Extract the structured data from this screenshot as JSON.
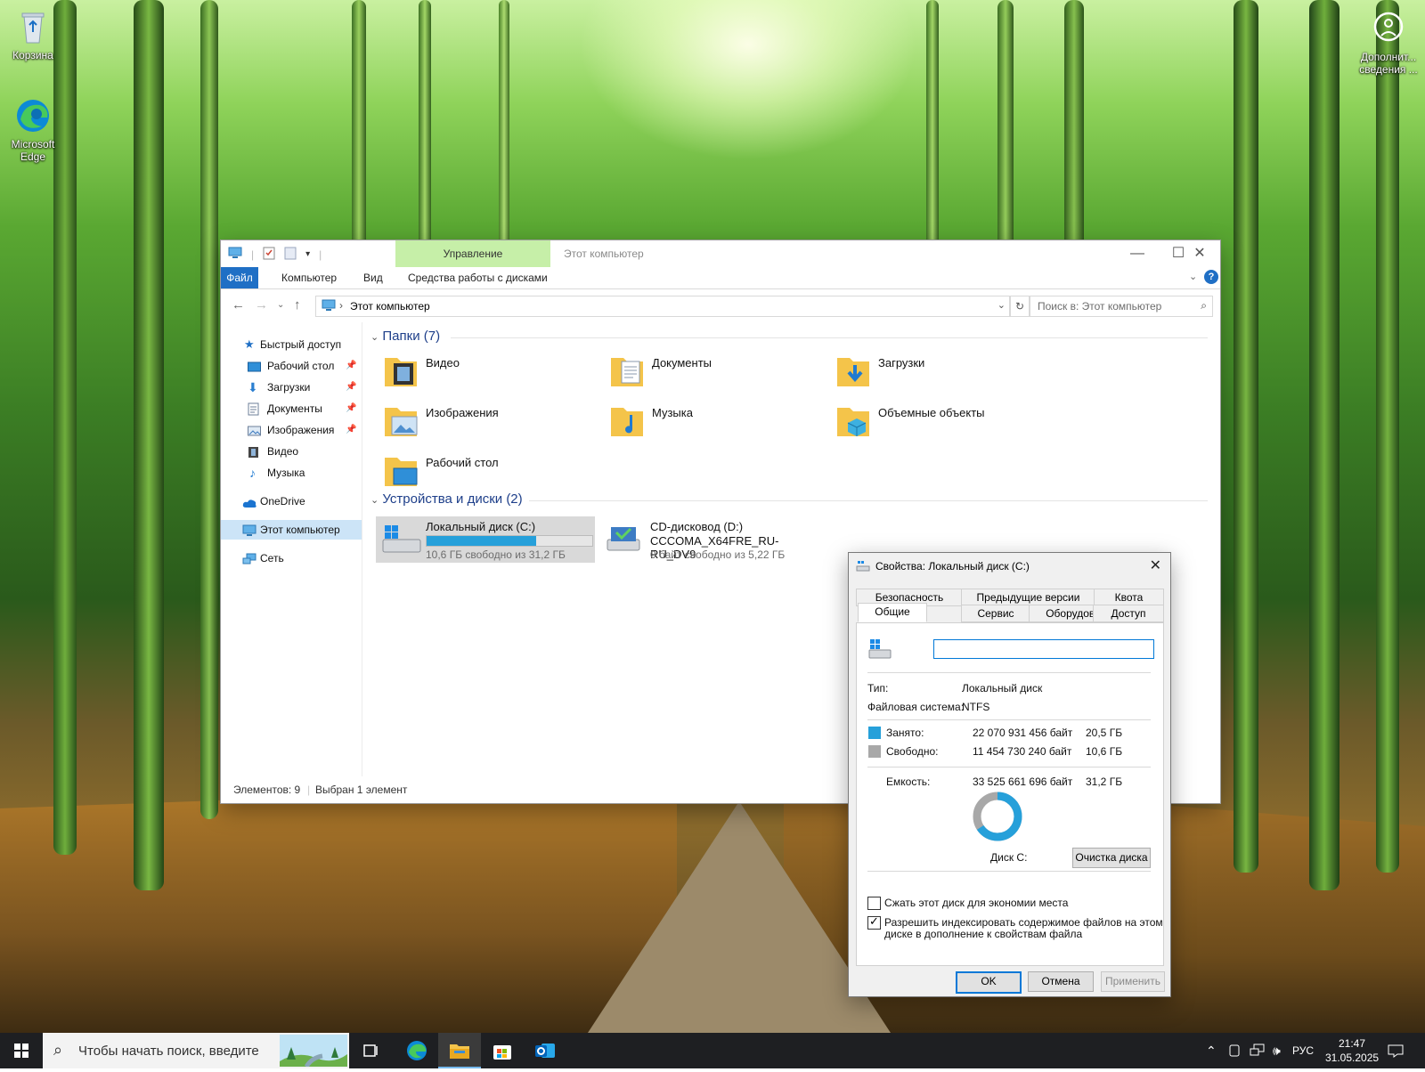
{
  "desktop": {
    "icons": [
      {
        "label": "Корзина",
        "icon": "recycle-bin-icon"
      },
      {
        "label": "Microsoft Edge",
        "icon": "edge-icon"
      }
    ],
    "widget": {
      "label": "Дополнит... сведения ...",
      "icon": "help-circle-icon"
    }
  },
  "explorer": {
    "context_tab": "Управление",
    "title": "Этот компьютер",
    "ribbon_tabs": [
      "Файл",
      "Компьютер",
      "Вид",
      "Средства работы с дисками"
    ],
    "address": "Этот компьютер",
    "search_placeholder": "Поиск в: Этот компьютер",
    "nav": {
      "quick_access": "Быстрый доступ",
      "items": [
        "Рабочий стол",
        "Загрузки",
        "Документы",
        "Изображения",
        "Видео",
        "Музыка"
      ],
      "onedrive": "OneDrive",
      "this_pc": "Этот компьютер",
      "network": "Сеть"
    },
    "folders_header": "Папки (7)",
    "folders": [
      "Видео",
      "Документы",
      "Загрузки",
      "Изображения",
      "Музыка",
      "Объемные объекты",
      "Рабочий стол"
    ],
    "drives_header": "Устройства и диски (2)",
    "drives": [
      {
        "name": "Локальный диск (C:)",
        "free_text": "10,6 ГБ свободно из 31,2 ГБ",
        "used_fraction": 0.66
      },
      {
        "name": "CD-дисковод (D:)",
        "label": "CCCOMA_X64FRE_RU-RU_DV9",
        "free_text": "0 байт свободно из 5,22 ГБ"
      }
    ],
    "status": {
      "items": "Элементов: 9",
      "selected": "Выбран 1 элемент"
    }
  },
  "dialog": {
    "title": "Свойства: Локальный диск (C:)",
    "tabs_row1": [
      "Безопасность",
      "Предыдущие версии",
      "Квота"
    ],
    "tabs_row2": [
      "Общие",
      "Сервис",
      "Оборудование",
      "Доступ"
    ],
    "name_value": "",
    "type_label": "Тип:",
    "type_value": "Локальный диск",
    "fs_label": "Файловая система:",
    "fs_value": "NTFS",
    "used_label": "Занято:",
    "used_bytes": "22 070 931 456 байт",
    "used_gb": "20,5 ГБ",
    "free_label": "Свободно:",
    "free_bytes": "11 454 730 240 байт",
    "free_gb": "10,6 ГБ",
    "cap_label": "Емкость:",
    "cap_bytes": "33 525 661 696 байт",
    "cap_gb": "31,2 ГБ",
    "used_fraction": 0.658,
    "used_color": "#26a0da",
    "free_color": "#a8a8a8",
    "disk_label": "Диск C:",
    "cleanup_button": "Очистка диска",
    "compress_label": "Сжать этот диск для экономии места",
    "compress_checked": false,
    "index_label_1": "Разрешить индексировать содержимое файлов на этом",
    "index_label_2": "диске в дополнение к свойствам файла",
    "index_checked": true,
    "ok": "OK",
    "cancel": "Отмена",
    "apply": "Применить"
  },
  "taskbar": {
    "search_placeholder": "Чтобы начать поиск, введите",
    "apps": [
      "task-view-icon",
      "edge-icon",
      "file-explorer-icon",
      "store-icon",
      "outlook-icon"
    ],
    "lang": "РУС",
    "time": "21:47",
    "date": "31.05.2025"
  }
}
